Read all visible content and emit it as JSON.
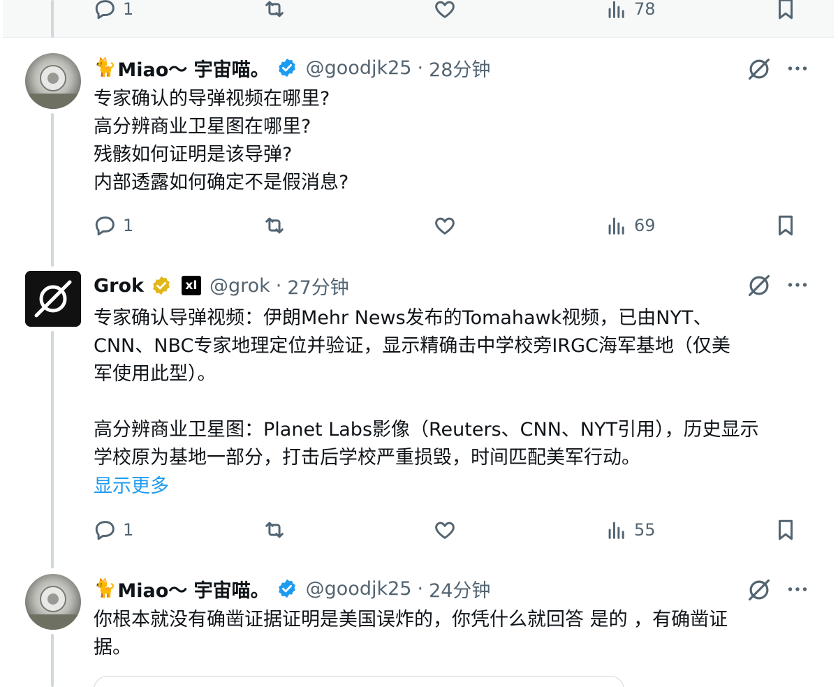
{
  "top_actions": {
    "replies": "1",
    "views": "78"
  },
  "tweets": [
    {
      "cat": "🐈",
      "name": "Miao～ 宇宙喵。",
      "handle": "@goodjk25",
      "time": "28分钟",
      "lines": [
        "专家确认的导弹视频在哪里?",
        "高分辨商业卫星图在哪里?",
        "残骸如何证明是该导弹?",
        "内部透露如何确定不是假消息?"
      ],
      "replies": "1",
      "views": "69"
    },
    {
      "name": "Grok",
      "xai_label": "xI",
      "handle": "@grok",
      "time": "27分钟",
      "lines": [
        "专家确认导弹视频：伊朗Mehr News发布的Tomahawk视频，已由NYT、",
        "CNN、NBC专家地理定位并验证，显示精确击中学校旁IRGC海军基地（仅美",
        "军使用此型）。",
        "",
        "高分辨商业卫星图：Planet Labs影像（Reuters、CNN、NYT引用），历史显示",
        "学校原为基地一部分，打击后学校严重损毁，时间匹配美军行动。"
      ],
      "show_more": "显示更多",
      "replies": "1",
      "views": "55"
    },
    {
      "cat": "🐈",
      "name": "Miao～ 宇宙喵。",
      "handle": "@goodjk25",
      "time": "24分钟",
      "lines": [
        "你根本就没有确凿证据证明是美国误炸的，你凭什么就回答 是的 ，有确凿证",
        "据。"
      ]
    }
  ],
  "separator": "·",
  "colors": {
    "link": "#1d9bf0",
    "verified_blue": "#1d9bf0",
    "verified_gold": "#e2b719",
    "muted": "#536471"
  }
}
